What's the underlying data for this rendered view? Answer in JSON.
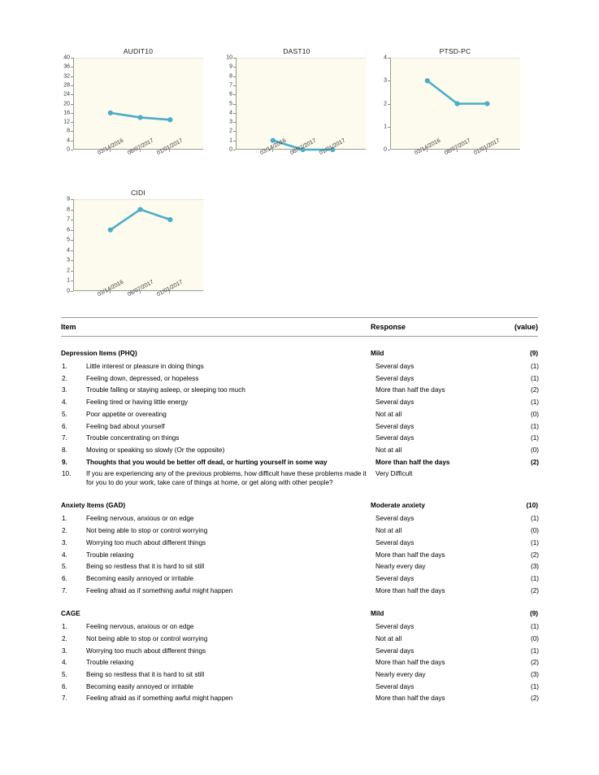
{
  "chart_data": [
    {
      "type": "line",
      "title": "AUDIT10",
      "x": [
        "03/14/2016",
        "08/07/2017",
        "01/01/2017"
      ],
      "values": [
        16,
        14,
        13
      ],
      "yticks": [
        0,
        4,
        8,
        12,
        16,
        20,
        24,
        28,
        32,
        36,
        40
      ],
      "ylim": [
        0,
        40
      ],
      "xlabel": "",
      "ylabel": "",
      "grid": false,
      "legend": "none",
      "series_color": "#4badc8"
    },
    {
      "type": "line",
      "title": "DAST10",
      "x": [
        "03/14/2016",
        "08/07/2017",
        "01/01/2017"
      ],
      "values": [
        1,
        0,
        0
      ],
      "yticks": [
        0,
        1,
        2,
        3,
        4,
        5,
        6,
        7,
        8,
        9,
        10
      ],
      "ylim": [
        0,
        10
      ],
      "xlabel": "",
      "ylabel": "",
      "grid": false,
      "legend": "none",
      "series_color": "#4badc8"
    },
    {
      "type": "line",
      "title": "PTSD-PC",
      "x": [
        "03/14/2016",
        "08/07/2017",
        "01/01/2017"
      ],
      "values": [
        3,
        2,
        2
      ],
      "yticks": [
        0,
        1,
        2,
        3,
        4
      ],
      "ylim": [
        0,
        4
      ],
      "xlabel": "",
      "ylabel": "",
      "grid": false,
      "legend": "none",
      "series_color": "#4badc8"
    },
    {
      "type": "line",
      "title": "CIDI",
      "x": [
        "03/14/2016",
        "08/07/2017",
        "01/01/2017"
      ],
      "values": [
        6,
        8,
        7
      ],
      "yticks": [
        0,
        1,
        2,
        3,
        4,
        5,
        6,
        7,
        8,
        9
      ],
      "ylim": [
        0,
        9
      ],
      "xlabel": "",
      "ylabel": "",
      "grid": false,
      "legend": "none",
      "series_color": "#4badc8"
    }
  ],
  "table": {
    "headers": {
      "item": "Item",
      "response": "Response",
      "value": "(value)"
    },
    "sections": [
      {
        "title": "Depression Items (PHQ)",
        "summary_response": "Mild",
        "summary_value": "(9)",
        "rows": [
          {
            "num": "1.",
            "text": "Little interest or pleasure in doing things",
            "response": "Several days",
            "value": "(1)",
            "bold": false
          },
          {
            "num": "2.",
            "text": "Feeling down, depressed, or hopeless",
            "response": "Several days",
            "value": "(1)",
            "bold": false
          },
          {
            "num": "3.",
            "text": "Trouble falling or staying asleep, or sleeping too much",
            "response": "More than half the days",
            "value": "(2)",
            "bold": false
          },
          {
            "num": "4.",
            "text": "Feeling tired or having little energy",
            "response": "Several days",
            "value": "(1)",
            "bold": false
          },
          {
            "num": "5.",
            "text": "Poor appetite or overeating",
            "response": "Not at all",
            "value": "(0)",
            "bold": false
          },
          {
            "num": "6.",
            "text": "Feeling bad about yourself",
            "response": "Several days",
            "value": "(1)",
            "bold": false
          },
          {
            "num": "7.",
            "text": "Trouble concentrating on things",
            "response": "Several days",
            "value": "(1)",
            "bold": false
          },
          {
            "num": "8.",
            "text": "Moving or speaking so slowly (Or the opposite)",
            "response": "Not at all",
            "value": "(0)",
            "bold": false
          },
          {
            "num": "9.",
            "text": "Thoughts that you would be better off dead, or hurting yourself in some way",
            "response": "More than half the days",
            "value": "(2)",
            "bold": true
          },
          {
            "num": "10.",
            "text": "If you are experiencing any of the previous problems, how difficult have these problems made it for you to do your work, take care of things at home, or get along with other people?",
            "response": "Very Difficult",
            "value": "",
            "bold": false
          }
        ]
      },
      {
        "title": "Anxiety Items (GAD)",
        "summary_response": "Moderate anxiety",
        "summary_value": "(10)",
        "rows": [
          {
            "num": "1.",
            "text": "Feeling nervous, anxious or on edge",
            "response": "Several days",
            "value": "(1)",
            "bold": false
          },
          {
            "num": "2.",
            "text": "Not being able to stop or control worrying",
            "response": "Not at all",
            "value": "(0)",
            "bold": false
          },
          {
            "num": "3.",
            "text": "Worrying too much about different things",
            "response": "Several days",
            "value": "(1)",
            "bold": false
          },
          {
            "num": "4.",
            "text": "Trouble relaxing",
            "response": "More than half the days",
            "value": "(2)",
            "bold": false
          },
          {
            "num": "5.",
            "text": "Being so restless that it is hard to sit still",
            "response": "Nearly every day",
            "value": "(3)",
            "bold": false
          },
          {
            "num": "6.",
            "text": "Becoming easily annoyed or irritable",
            "response": "Several days",
            "value": "(1)",
            "bold": false
          },
          {
            "num": "7.",
            "text": "Feeling afraid as if something awful might happen",
            "response": "More than half the days",
            "value": "(2)",
            "bold": false
          }
        ]
      },
      {
        "title": "CAGE",
        "summary_response": "Mild",
        "summary_value": "(9)",
        "rows": [
          {
            "num": "1.",
            "text": "Feeling nervous, anxious or on edge",
            "response": "Several days",
            "value": "(1)",
            "bold": false
          },
          {
            "num": "2.",
            "text": "Not being able to stop or control worrying",
            "response": "Not at all",
            "value": "(0)",
            "bold": false
          },
          {
            "num": "3.",
            "text": "Worrying too much about different things",
            "response": "Several days",
            "value": "(1)",
            "bold": false
          },
          {
            "num": "4.",
            "text": "Trouble relaxing",
            "response": "More than half the days",
            "value": "(2)",
            "bold": false
          },
          {
            "num": "5.",
            "text": "Being so restless that it is hard to sit still",
            "response": "Nearly every day",
            "value": "(3)",
            "bold": false
          },
          {
            "num": "6.",
            "text": "Becoming easily annoyed or irritable",
            "response": "Several days",
            "value": "(1)",
            "bold": false
          },
          {
            "num": "7.",
            "text": "Feeling afraid as if something awful might happen",
            "response": "More than half the days",
            "value": "(2)",
            "bold": false
          }
        ]
      }
    ]
  }
}
